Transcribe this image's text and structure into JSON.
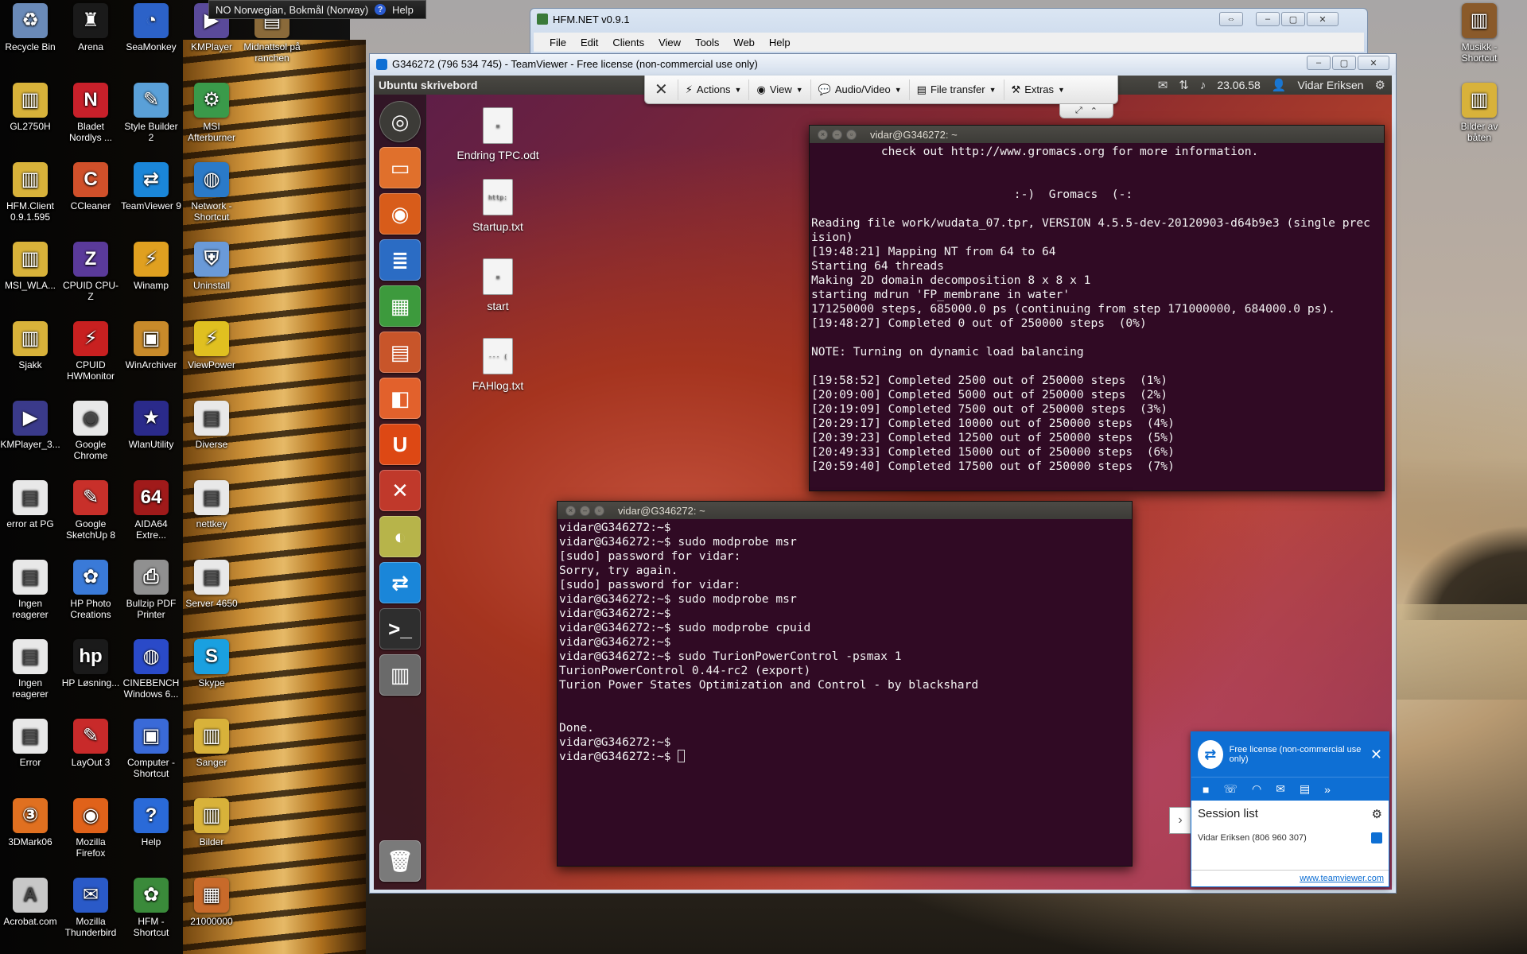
{
  "language_bar": {
    "language": "NO Norwegian, Bokmål (Norway)",
    "help": "Help"
  },
  "desktop_icons": [
    "Recycle Bin",
    "Arena",
    "SeaMonkey",
    "KMPlayer",
    "Midnattsol på ranchen",
    "GL2750H",
    "Bladet Nordlys ...",
    "Style Builder 2",
    "MSI Afterburner",
    "HFM.Client 0.9.1.595",
    "CCleaner",
    "TeamViewer 9",
    "Network - Shortcut",
    "MSI_WLA...",
    "CPUID CPU-Z",
    "Winamp",
    "Uninstall",
    "Sjakk",
    "CPUID HWMonitor",
    "WinArchiver",
    "ViewPower",
    "KMPlayer_3...",
    "Google Chrome",
    "WlanUtility",
    "Diverse",
    "error at PG",
    "Google SketchUp 8",
    "AIDA64 Extre...",
    "nettkey",
    "Ingen reagerer",
    "HP Photo Creations",
    "Bullzip PDF Printer",
    "Server 4650",
    "Ingen reagerer",
    "HP Løsning...",
    "CINEBENCH Windows 6...",
    "Skype",
    "Error",
    "LayOut 3",
    "Computer - Shortcut",
    "Sanger",
    "3DMark06",
    "Mozilla Firefox",
    "Help",
    "Bilder",
    "Acrobat.com",
    "Mozilla Thunderbird",
    "HFM - Shortcut",
    "21000000",
    "Musikk - Shortcut",
    "Bilder av båten"
  ],
  "hfm": {
    "title": "HFM.NET v0.9.1",
    "menu": [
      "File",
      "Edit",
      "Clients",
      "View",
      "Tools",
      "Web",
      "Help"
    ]
  },
  "teamviewer": {
    "title": "G346272 (796 534 745) - TeamViewer - Free license (non-commercial use only)",
    "toolbar": [
      "Actions",
      "View",
      "Audio/Video",
      "File transfer",
      "Extras"
    ]
  },
  "ubuntu": {
    "desktop_title": "Ubuntu skrivebord",
    "time": "23.06.58",
    "user": "Vidar Eriksen",
    "files": [
      "Endring TPC.odt",
      "Startup.txt",
      "start",
      "FAHlog.txt"
    ]
  },
  "term1": {
    "title": "vidar@G346272: ~",
    "lines": [
      "          check out http://www.gromacs.org for more information.",
      "",
      "",
      "                             :-)  Gromacs  (-:",
      "",
      "Reading file work/wudata_07.tpr, VERSION 4.5.5-dev-20120903-d64b9e3 (single prec",
      "ision)",
      "[19:48:21] Mapping NT from 64 to 64",
      "Starting 64 threads",
      "Making 2D domain decomposition 8 x 8 x 1",
      "starting mdrun 'FP_membrane in water'",
      "171250000 steps, 685000.0 ps (continuing from step 171000000, 684000.0 ps).",
      "[19:48:27] Completed 0 out of 250000 steps  (0%)",
      "",
      "NOTE: Turning on dynamic load balancing",
      "",
      "[19:58:52] Completed 2500 out of 250000 steps  (1%)",
      "[20:09:00] Completed 5000 out of 250000 steps  (2%)",
      "[20:19:09] Completed 7500 out of 250000 steps  (3%)",
      "[20:29:17] Completed 10000 out of 250000 steps  (4%)",
      "[20:39:23] Completed 12500 out of 250000 steps  (5%)",
      "[20:49:33] Completed 15000 out of 250000 steps  (6%)",
      "[20:59:40] Completed 17500 out of 250000 steps  (7%)"
    ]
  },
  "term2": {
    "title": "vidar@G346272: ~",
    "lines": [
      "vidar@G346272:~$",
      "vidar@G346272:~$ sudo modprobe msr",
      "[sudo] password for vidar:",
      "Sorry, try again.",
      "[sudo] password for vidar:",
      "vidar@G346272:~$ sudo modprobe msr",
      "vidar@G346272:~$",
      "vidar@G346272:~$ sudo modprobe cpuid",
      "vidar@G346272:~$",
      "vidar@G346272:~$ sudo TurionPowerControl -psmax 1",
      "TurionPowerControl 0.44-rc2 (export)",
      "Turion Power States Optimization and Control - by blackshard",
      "",
      "",
      "Done.",
      "vidar@G346272:~$"
    ],
    "prompt": "vidar@G346272:~$ "
  },
  "session_panel": {
    "license": "Free license (non-commercial use only)",
    "list_title": "Session list",
    "entry": "Vidar Eriksen (806 960 307)",
    "link": "www.teamviewer.com"
  }
}
